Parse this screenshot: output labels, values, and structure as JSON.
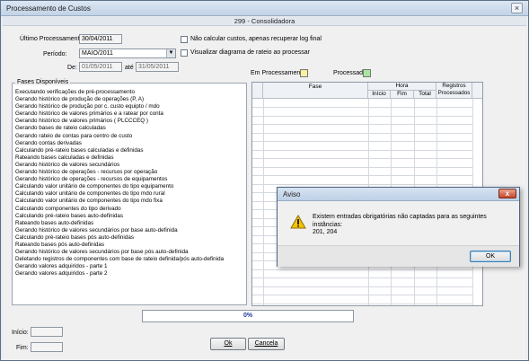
{
  "window": {
    "title": "Processamento de Custos",
    "close_glyph": "×"
  },
  "header": {
    "company": "299 - Consolidadora"
  },
  "form": {
    "ultimo_label": "Último Processamento:",
    "ultimo_value": "30/04/2011",
    "periodo_label": "Período:",
    "periodo_value": "MAIO/2011",
    "de_label": "De:",
    "de_value": "01/05/2011",
    "ate_label": "até",
    "ate_value": "31/05/2011",
    "chk_nao_calcular": "Não calcular custos, apenas recuperar log final",
    "chk_visualizar": "Visualizar diagrama de rateio ao processar"
  },
  "legend": {
    "em_processamento": "Em Processamento",
    "processado": "Processado",
    "em_processamento_color": "#f7f0a0",
    "processado_color": "#a8e6a0"
  },
  "phases": {
    "title": "Fases Disponíveis",
    "items": [
      "Executando verificações de pré-processamento",
      "Gerando histórico de produção de operações (P, A)",
      "Gerando histórico de produção por c. custo equipto / mdo",
      "Gerando histórico de valores primários e a ratear por conta",
      "Gerando histórico de valores primários ( PLCCCEQ )",
      "Gerando bases de rateio calculadas",
      "Gerando rateio de contas para centro de custo",
      "Gerando contas derivadas",
      "Calculando pré-rateio bases calculadas e definidas",
      "Rateando bases calculadas e definidas",
      "Gerando histórico de valores secundários",
      "Gerando histórico de operações - recursos por operação",
      "Gerando histórico de operações - recursos de equipamentos",
      "Calculando valor unitário de componentes do tipo equipamento",
      "Calculando valor unitário de componentes do tipo mdo rural",
      "Calculando valor unitário de componentes do tipo mdo fixa",
      "Calculando componentes do tipo derivado",
      "Calculando pré-rateio bases auto-definidas",
      "Rateando bases auto-definidas",
      "Gerando histórico de valores secundários por base auto-definida",
      "Calculando pré-rateio bases pós auto-definidas",
      "Rateando bases pós auto-definidas",
      "Gerando histórico de valores secundários por base pós auto-definida",
      "Deletando registros de componentes com base de rateio definida/pós auto-definida",
      "Gerando valores adquiridos - parte 1",
      "Gerando valores adquiridos - parte 2"
    ]
  },
  "grid": {
    "col_fase": "Fase",
    "col_hora": "Hora",
    "col_inicio": "Início",
    "col_fim": "Fim",
    "col_total": "Total",
    "col_registros": "Registros Processados"
  },
  "progress": {
    "percent": 0,
    "label": "0%"
  },
  "footer": {
    "inicio_label": "Início:",
    "fim_label": "Fim:",
    "ok_label": "Ok",
    "cancela_label": "Cancela"
  },
  "dialog": {
    "title": "Aviso",
    "close_glyph": "x",
    "message_line1": "Existem entradas obrigatórias não captadas para as seguintes instâncias:",
    "message_line2": "201, 204",
    "ok_label": "OK",
    "icon": "warning-icon"
  }
}
